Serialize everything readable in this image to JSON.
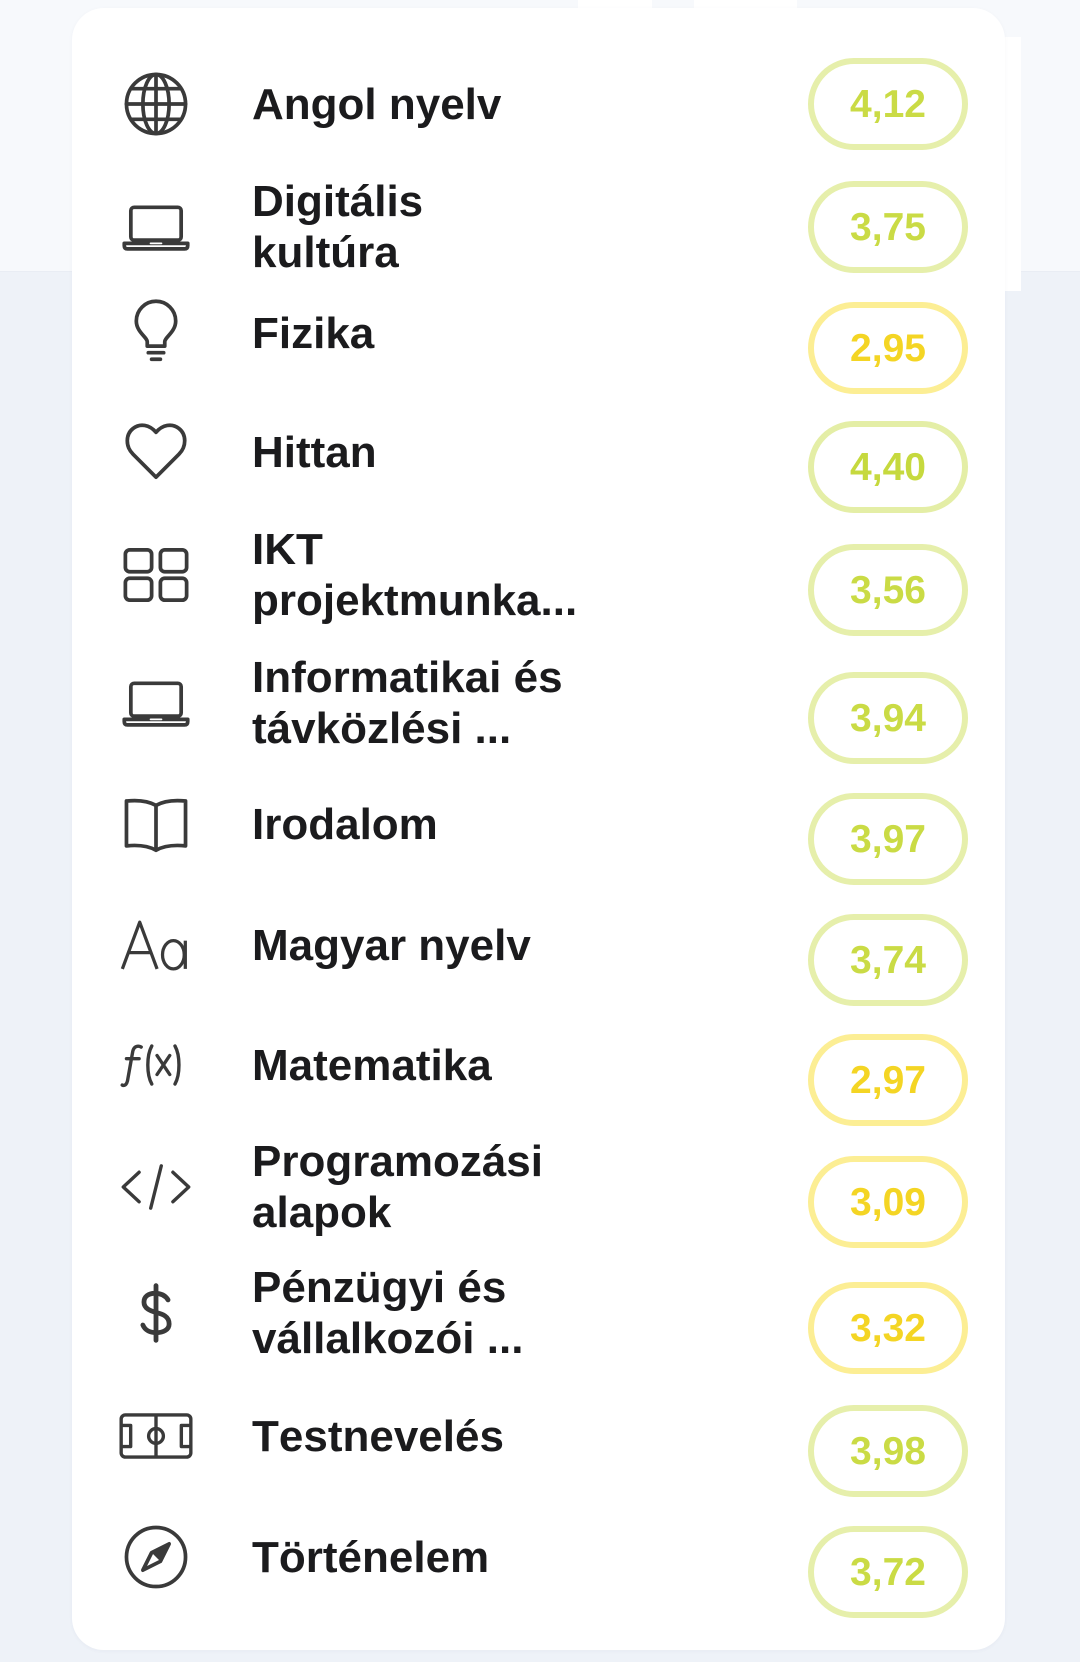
{
  "subjects": [
    {
      "name": "Angol nyelv",
      "icon": "globe-icon",
      "average": "4,12",
      "badge_color": "#cadb45",
      "badge_border_color": "#e6efab"
    },
    {
      "name": "Digitális kultúra",
      "icon": "laptop-icon",
      "average": "3,75",
      "badge_color": "#cadb45",
      "badge_border_color": "#e6efab"
    },
    {
      "name": "Fizika",
      "icon": "lightbulb-icon",
      "average": "2,95",
      "badge_color": "#f4d524",
      "badge_border_color": "#fcee94"
    },
    {
      "name": "Hittan",
      "icon": "heart-icon",
      "average": "4,40",
      "badge_color": "#c6d93e",
      "badge_border_color": "#e4eea6"
    },
    {
      "name": "IKT projektmunka...",
      "icon": "grid-icon",
      "average": "3,56",
      "badge_color": "#cadb45",
      "badge_border_color": "#e6efab"
    },
    {
      "name": "Informatikai és távközlési ...",
      "icon": "laptop-icon",
      "average": "3,94",
      "badge_color": "#cadb45",
      "badge_border_color": "#e6efab"
    },
    {
      "name": "Irodalom",
      "icon": "book-icon",
      "average": "3,97",
      "badge_color": "#cadb45",
      "badge_border_color": "#e6efab"
    },
    {
      "name": "Magyar nyelv",
      "icon": "text-format-icon",
      "average": "3,74",
      "badge_color": "#cadb45",
      "badge_border_color": "#e6efab"
    },
    {
      "name": "Matematika",
      "icon": "function-icon",
      "average": "2,97",
      "badge_color": "#f4d524",
      "badge_border_color": "#fcee94"
    },
    {
      "name": "Programozási alapok",
      "icon": "code-icon",
      "average": "3,09",
      "badge_color": "#f4d524",
      "badge_border_color": "#fcee94"
    },
    {
      "name": "Pénzügyi és vállalkozói ...",
      "icon": "dollar-icon",
      "average": "3,32",
      "badge_color": "#f4d524",
      "badge_border_color": "#fcee94"
    },
    {
      "name": "Testnevelés",
      "icon": "sports-field-icon",
      "average": "3,98",
      "badge_color": "#cadb45",
      "badge_border_color": "#e6efab"
    },
    {
      "name": "Történelem",
      "icon": "compass-icon",
      "average": "3,72",
      "badge_color": "#cadb45",
      "badge_border_color": "#e6efab"
    }
  ]
}
